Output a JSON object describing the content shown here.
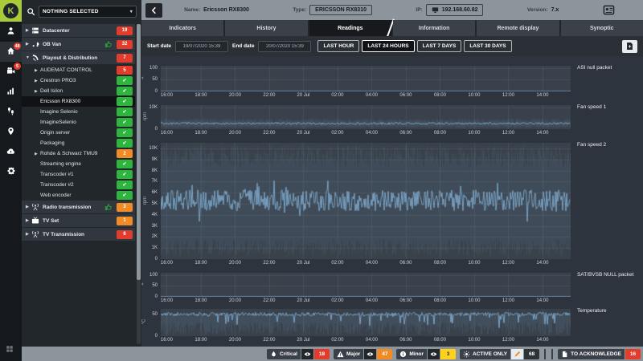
{
  "colors": {
    "red": "#e23c2c",
    "orange": "#f08b26",
    "green": "#2eb53e",
    "yellow": "#ffd11a",
    "accent": "#a8cc39",
    "chart_line": "#8cbbe0"
  },
  "rail": {
    "items": [
      {
        "name": "user",
        "icon": "user"
      },
      {
        "name": "home",
        "icon": "home",
        "badge": "48",
        "active": true
      },
      {
        "name": "video",
        "icon": "video",
        "badge": "5"
      },
      {
        "name": "statistics",
        "icon": "stats"
      },
      {
        "name": "footprints",
        "icon": "footprints"
      },
      {
        "name": "location",
        "icon": "pin"
      },
      {
        "name": "cloud",
        "icon": "cloud"
      },
      {
        "name": "settings",
        "icon": "gear"
      }
    ],
    "logo_letter": "K"
  },
  "sidebar": {
    "search": {
      "selected": "NOTHING SELECTED"
    },
    "groups": [
      {
        "label": "Datacenter",
        "icon": "server",
        "badge": {
          "kind": "count",
          "color": "red",
          "value": "19"
        }
      },
      {
        "label": "OB Van",
        "icon": "van",
        "thumbs_up": true,
        "badge": {
          "kind": "count",
          "color": "red",
          "value": "32"
        }
      },
      {
        "label": "Playout & Distribution",
        "icon": "dish",
        "expanded": true,
        "badge": {
          "kind": "count",
          "color": "red",
          "value": "7"
        },
        "children": [
          {
            "label": "AUDEMAT CONTROL",
            "arrow": true,
            "badge": {
              "kind": "count",
              "color": "red",
              "value": "5"
            }
          },
          {
            "label": "Crestron PRO3",
            "arrow": true,
            "badge": {
              "kind": "check"
            }
          },
          {
            "label": "Dell Isilon",
            "arrow": true,
            "badge": {
              "kind": "check"
            }
          },
          {
            "label": "Ericsson RX8300",
            "selected": true,
            "badge": {
              "kind": "check"
            }
          },
          {
            "label": "Imagine Selenio",
            "badge": {
              "kind": "check"
            }
          },
          {
            "label": "ImagineSelenio",
            "badge": {
              "kind": "check"
            }
          },
          {
            "label": "Origin server",
            "badge": {
              "kind": "check"
            }
          },
          {
            "label": "Packaging",
            "badge": {
              "kind": "check"
            }
          },
          {
            "label": "Rohde & Schwarz TMU9",
            "arrow": true,
            "badge": {
              "kind": "count",
              "color": "orange",
              "value": "2"
            }
          },
          {
            "label": "Streaming engine",
            "badge": {
              "kind": "check"
            }
          },
          {
            "label": "Transcoder #1",
            "badge": {
              "kind": "check"
            }
          },
          {
            "label": "Transcoder #2",
            "badge": {
              "kind": "check"
            }
          },
          {
            "label": "Web encoder",
            "badge": {
              "kind": "check"
            }
          }
        ]
      },
      {
        "label": "Radio transmission",
        "icon": "antenna",
        "thumbs_up": true,
        "badge": {
          "kind": "count",
          "color": "orange",
          "value": "3"
        }
      },
      {
        "label": "TV Set",
        "icon": "tv",
        "badge": {
          "kind": "count",
          "color": "orange",
          "value": "1"
        }
      },
      {
        "label": "TV Transmission",
        "icon": "antenna",
        "badge": {
          "kind": "count",
          "color": "red",
          "value": "6"
        }
      }
    ]
  },
  "header": {
    "name_label": "Name:",
    "name_value": "Ericsson RX8300",
    "type_label": "Type:",
    "type_value": "ERICSSON RX8310",
    "ip_label": "IP:",
    "ip_value": "192.168.60.82",
    "version_label": "Version:",
    "version_value": "7.x"
  },
  "tabs": {
    "items": [
      "Indicators",
      "History",
      "Readings",
      "Information",
      "Remote display",
      "Synoptic"
    ],
    "active": "Readings"
  },
  "filters": {
    "start_label": "Start date",
    "start_value": "19/07/2020 15:39",
    "end_label": "End date",
    "end_value": "20/07/2020 15:39",
    "ranges": [
      "LAST HOUR",
      "LAST 24 HOURS",
      "LAST 7 DAYS",
      "LAST 30 DAYS"
    ],
    "active_range": "LAST 24 HOURS"
  },
  "chart_data": [
    {
      "type": "line",
      "title": "ASI null packet",
      "y_unit": "#",
      "x_start": "19/07/2020 15:39",
      "x_end": "20/07/2020 15:39",
      "x_ticks": [
        "16:00",
        "18:00",
        "20:00",
        "22:00",
        "20 Jul",
        "02:00",
        "04:00",
        "06:00",
        "08:00",
        "10:00",
        "12:00",
        "14:00"
      ],
      "y_range": [
        0,
        110
      ],
      "y_ticks": [
        {
          "label": "100",
          "value": 100
        },
        {
          "label": "50",
          "value": 50
        },
        {
          "label": "0",
          "value": 0
        }
      ],
      "series": [
        {
          "name": "ASI null packet",
          "profile": "flat at zero",
          "sampled": [
            0,
            0,
            0,
            0,
            0,
            0,
            0,
            0,
            0,
            0,
            0,
            0
          ]
        }
      ],
      "render": {
        "kind": "flat"
      }
    },
    {
      "type": "line",
      "title": "Fan speed 1",
      "y_unit": "rpm",
      "x_start": "19/07/2020 15:39",
      "x_end": "20/07/2020 15:39",
      "x_ticks": [
        "16:00",
        "18:00",
        "20:00",
        "22:00",
        "20 Jul",
        "02:00",
        "04:00",
        "06:00",
        "08:00",
        "10:00",
        "12:00",
        "14:00"
      ],
      "y_range": [
        0,
        11000
      ],
      "y_ticks": [
        {
          "label": "10K",
          "value": 10000
        },
        {
          "label": "0",
          "value": 0
        }
      ],
      "series": [
        {
          "name": "Fan speed 1",
          "profile": "noisy around 2600 rpm",
          "sampled": [
            2600,
            2520,
            2680,
            2550,
            2640,
            2600,
            2510,
            2690,
            2610,
            2560,
            2650,
            2600
          ]
        }
      ],
      "render": {
        "kind": "noise",
        "mean": 2600,
        "jitter": 480,
        "burst": 0,
        "faint_lo": [
          350,
          1400
        ],
        "faint_hi": [
          3300,
          4900
        ],
        "alpha": 0.12
      }
    },
    {
      "type": "line",
      "title": "Fan speed 2",
      "y_unit": "rpm",
      "x_start": "19/07/2020 15:39",
      "x_end": "20/07/2020 15:39",
      "x_ticks": [
        "16:00",
        "18:00",
        "20:00",
        "22:00",
        "20 Jul",
        "02:00",
        "04:00",
        "06:00",
        "08:00",
        "10:00",
        "12:00",
        "14:00"
      ],
      "y_range": [
        0,
        10500
      ],
      "y_ticks": [
        {
          "label": "10K",
          "value": 10000
        },
        {
          "label": "9K",
          "value": 9000
        },
        {
          "label": "8K",
          "value": 8000
        },
        {
          "label": "7K",
          "value": 7000
        },
        {
          "label": "6K",
          "value": 6000
        },
        {
          "label": "5K",
          "value": 5000
        },
        {
          "label": "4K",
          "value": 4000
        },
        {
          "label": "3K",
          "value": 3000
        },
        {
          "label": "2K",
          "value": 2000
        },
        {
          "label": "1K",
          "value": 1000
        },
        {
          "label": "0",
          "value": 0
        }
      ],
      "series": [
        {
          "name": "Fan speed 2",
          "profile": "noisy around 5300 rpm, excursions 1K-10K",
          "sampled": [
            5300,
            5150,
            5420,
            5240,
            5370,
            5280,
            5180,
            5430,
            5310,
            5220,
            5360,
            5300
          ]
        }
      ],
      "render": {
        "kind": "noise",
        "mean": 5300,
        "jitter": 950,
        "burst": 2400,
        "faint_lo": [
          300,
          1800
        ],
        "faint_hi": [
          8300,
          10300
        ],
        "alpha": 0.1
      }
    },
    {
      "type": "line",
      "title": "SAT/BVSB NULL packet",
      "y_unit": "#",
      "x_start": "19/07/2020 15:39",
      "x_end": "20/07/2020 15:39",
      "x_ticks": [
        "16:00",
        "18:00",
        "20:00",
        "22:00",
        "20 Jul",
        "02:00",
        "04:00",
        "06:00",
        "08:00",
        "10:00",
        "12:00",
        "14:00"
      ],
      "y_range": [
        0,
        110
      ],
      "y_ticks": [
        {
          "label": "100",
          "value": 100
        },
        {
          "label": "50",
          "value": 50
        },
        {
          "label": "0",
          "value": 0
        }
      ],
      "series": [
        {
          "name": "SAT/BVSB NULL packet",
          "profile": "flat at zero",
          "sampled": [
            0,
            0,
            0,
            0,
            0,
            0,
            0,
            0,
            0,
            0,
            0,
            0
          ]
        }
      ],
      "render": {
        "kind": "flat"
      }
    },
    {
      "type": "line",
      "title": "Temperature",
      "y_unit": "°C",
      "x_start": "19/07/2020 15:39",
      "x_end": "20/07/2020 15:39",
      "x_ticks": [
        "16:00",
        "18:00",
        "20:00",
        "22:00",
        "20 Jul",
        "02:00",
        "04:00",
        "06:00",
        "08:00",
        "10:00",
        "12:00",
        "14:00"
      ],
      "y_range": [
        0,
        62
      ],
      "y_ticks": [
        {
          "label": "50",
          "value": 50
        },
        {
          "label": "0",
          "value": 0
        }
      ],
      "series": [
        {
          "name": "Temperature",
          "profile": "around 50 with frequent downward dips",
          "sampled": [
            50,
            49,
            51,
            50,
            48,
            50,
            51,
            49,
            50,
            50,
            49,
            50
          ]
        }
      ],
      "render": {
        "kind": "temp",
        "mean": 50,
        "jitter": 4,
        "dip_chance": 0.1,
        "dip_depth": 28,
        "faint_lo": [
          2,
          32
        ],
        "alpha": 0.13
      }
    }
  ],
  "statusbar": {
    "groups": [
      {
        "name": "critical",
        "icon": "flame",
        "label": "Critical",
        "count": "18",
        "badge_color": "#e23c2c",
        "eye": true
      },
      {
        "name": "major",
        "icon": "warning",
        "label": "Major",
        "count": "47",
        "badge_color": "#f08b26",
        "eye": true
      },
      {
        "name": "minor",
        "icon": "infoc",
        "label": "Minor",
        "count": "3",
        "badge_color": "#ffd11a",
        "badge_text": "#333333",
        "eye": true
      },
      {
        "name": "active-only",
        "icon": "sun",
        "label": "ACTIVE ONLY",
        "count": "68",
        "badge_color": "#2e3338",
        "pencil": true
      },
      {
        "name": "to-acknowledge",
        "icon": "file",
        "label": "TO ACKNOWLEDGE",
        "count": "16",
        "badge_color": "#e23c2c",
        "separator_before": true
      }
    ]
  }
}
